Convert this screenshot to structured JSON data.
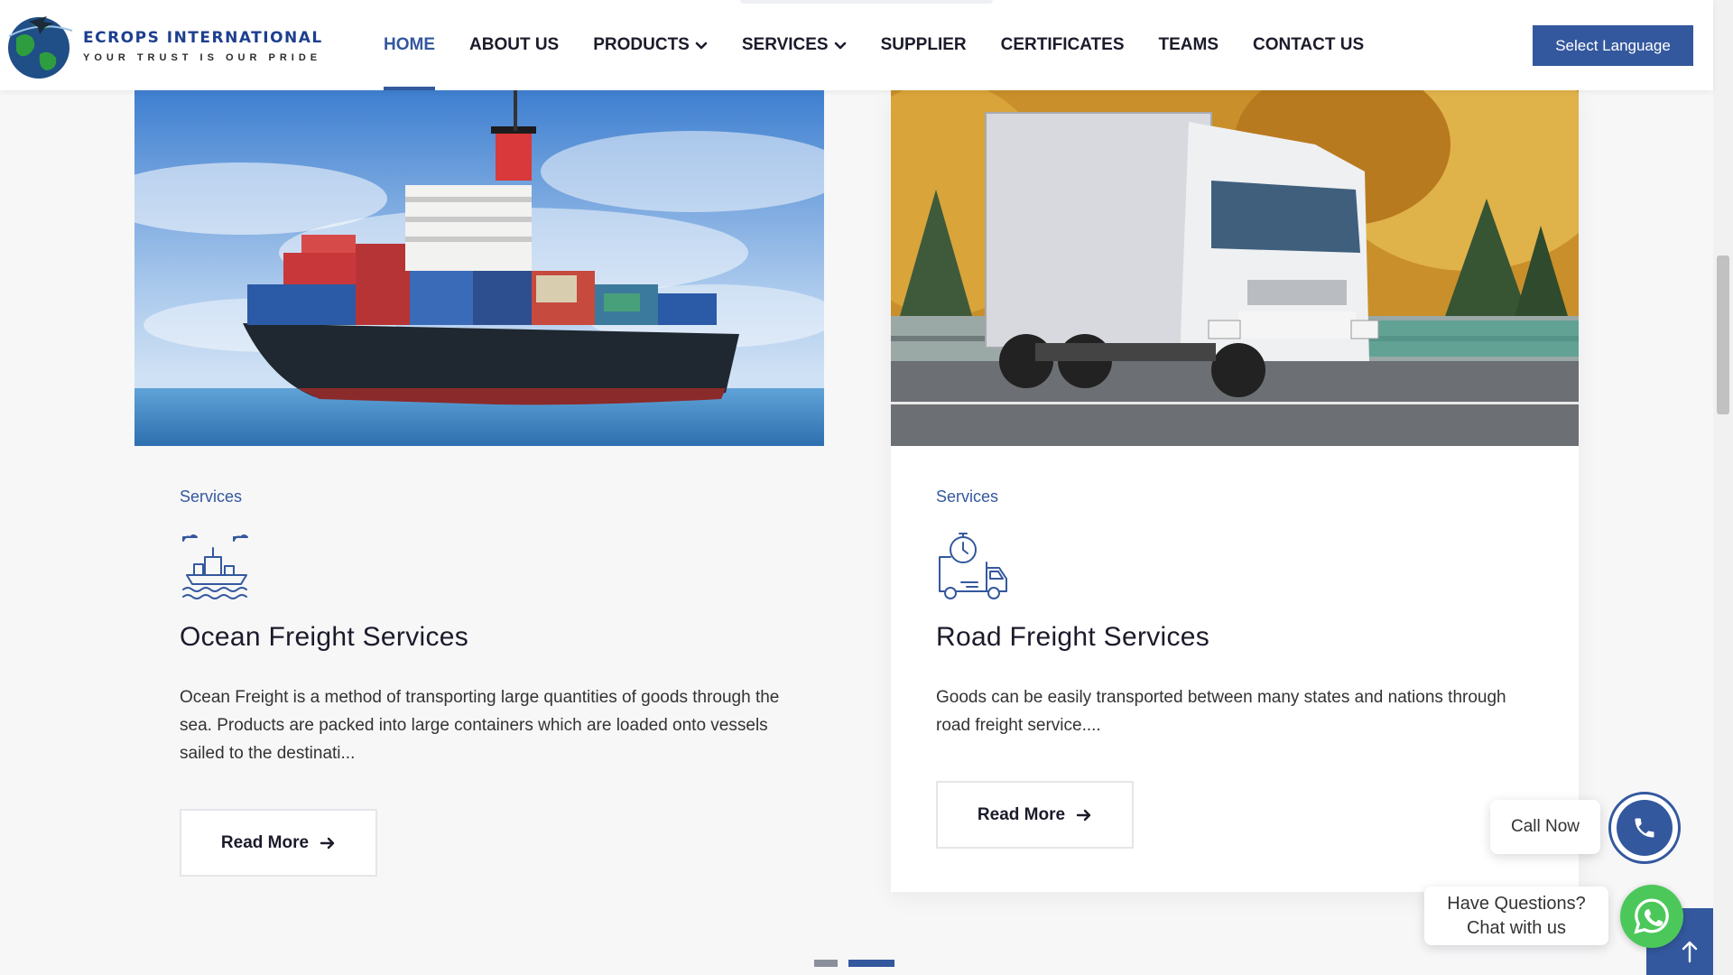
{
  "header": {
    "logo_name": "ECROPS INTERNATIONAL",
    "logo_tagline": "YOUR TRUST IS OUR PRIDE",
    "nav": [
      {
        "label": "HOME",
        "active": true
      },
      {
        "label": "ABOUT US"
      },
      {
        "label": "PRODUCTS",
        "dropdown": true
      },
      {
        "label": "SERVICES",
        "dropdown": true
      },
      {
        "label": "SUPPLIER"
      },
      {
        "label": "CERTIFICATES"
      },
      {
        "label": "TEAMS"
      },
      {
        "label": "CONTACT US"
      }
    ],
    "language_button": "Select Language"
  },
  "cards": [
    {
      "category": "Services",
      "icon": "ship-icon",
      "title": "Ocean Freight Services",
      "text": "Ocean Freight is a method of transporting large quantities of goods through the sea. Products are packed into large containers which are loaded onto vessels sailed to the destinati...",
      "button": "Read More"
    },
    {
      "category": "Services",
      "icon": "delivery-truck-icon",
      "title": "Road Freight Services",
      "text": "Goods can be easily transported between many states and nations through road freight service....",
      "button": "Read More"
    }
  ],
  "widgets": {
    "call_label": "Call Now",
    "chat_line1": "Have Questions?",
    "chat_line2": "Chat with us"
  },
  "colors": {
    "brand": "#34589e",
    "whatsapp": "#4cc85a"
  },
  "carousel": {
    "pages": 2,
    "active": 2
  }
}
